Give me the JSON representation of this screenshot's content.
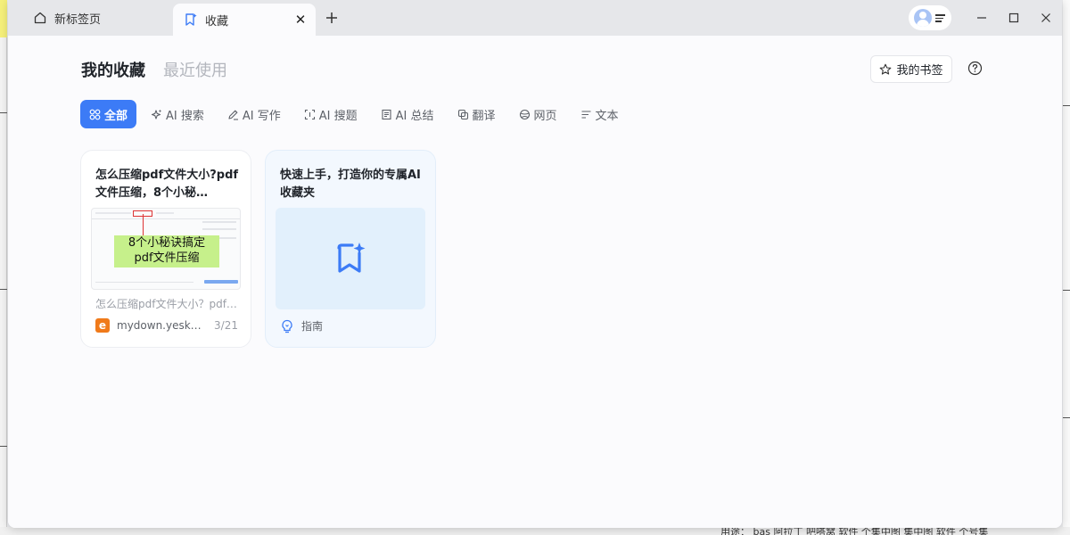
{
  "browser": {
    "tabs": [
      {
        "label": "新标签页",
        "icon": "home-icon",
        "active": false
      },
      {
        "label": "收藏",
        "icon": "bookmark-icon",
        "active": true
      }
    ]
  },
  "header": {
    "tabs": [
      {
        "label": "我的收藏",
        "active": true
      },
      {
        "label": "最近使用",
        "active": false
      }
    ],
    "bookmarks_button": "我的书签"
  },
  "filters": [
    {
      "label": "全部",
      "icon": "grid-icon",
      "active": true
    },
    {
      "label": "AI 搜索",
      "icon": "sparkle-icon",
      "active": false
    },
    {
      "label": "AI 写作",
      "icon": "pen-icon",
      "active": false
    },
    {
      "label": "AI 搜题",
      "icon": "scan-icon",
      "active": false
    },
    {
      "label": "AI 总结",
      "icon": "doc-icon",
      "active": false
    },
    {
      "label": "翻译",
      "icon": "translate-icon",
      "active": false
    },
    {
      "label": "网页",
      "icon": "globe-icon",
      "active": false
    },
    {
      "label": "文本",
      "icon": "text-icon",
      "active": false
    }
  ],
  "cards": [
    {
      "title": "怎么压缩pdf文件大小?pdf文件压缩，8个小秘…",
      "thumb_caption_line1": "8个小秘诀搞定",
      "thumb_caption_line2": "pdf文件压缩",
      "desc": "怎么压缩pdf文件大小？pdf…",
      "site": "mydown.yesk…",
      "date": "3/21"
    },
    {
      "title": "快速上手，打造你的专属AI 收藏夹",
      "tag": "指南"
    }
  ],
  "desktop": {
    "bottom_text": "用途：  bas  阿拉丁  吧嗒窝  软件  个集中图  集中图  软件  个号集"
  },
  "colors": {
    "accent": "#3c7bf6",
    "guide_bg": "#e2f0fc"
  }
}
